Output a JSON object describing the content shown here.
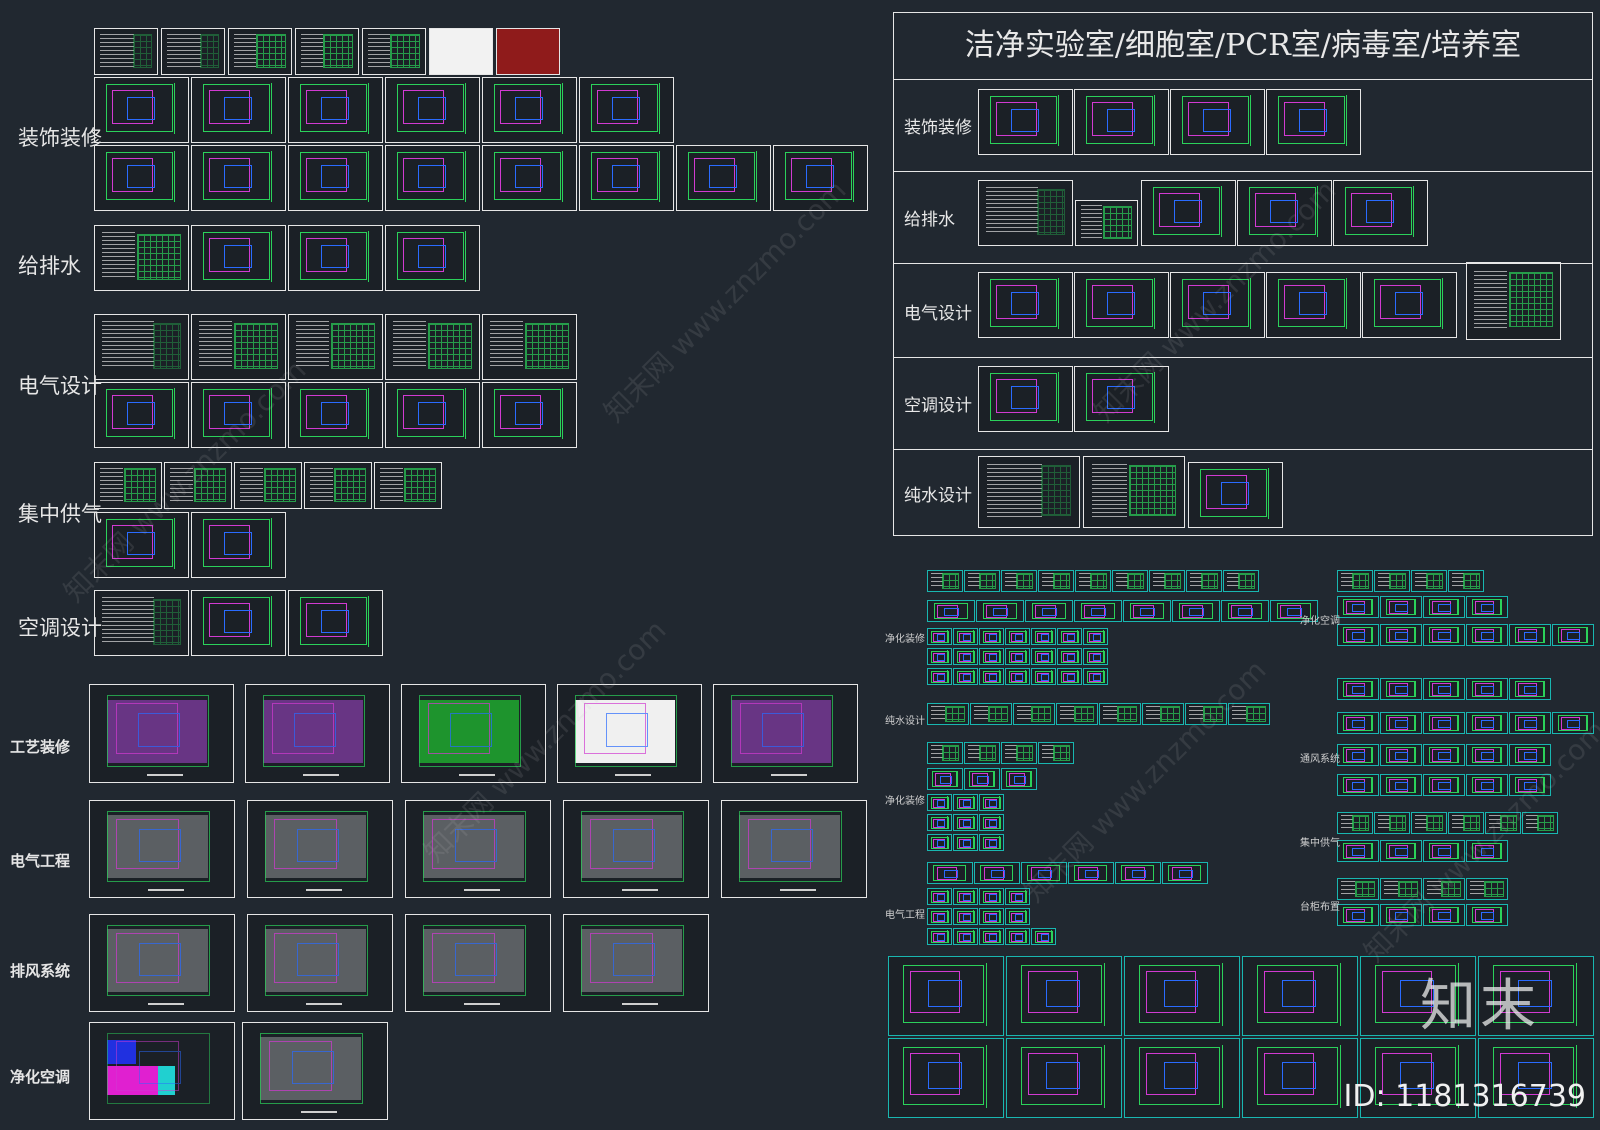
{
  "left_labels": [
    "装饰装修",
    "给排水",
    "电气设计",
    "集中供气",
    "空调设计"
  ],
  "bottom_labels": [
    "工艺装修",
    "电气工程",
    "排风系统",
    "净化空调"
  ],
  "panel": {
    "title": "洁净实验室/细胞室/PCR室/病毒室/培养室",
    "rows": [
      "装饰装修",
      "给排水",
      "电气设计",
      "空调设计",
      "纯水设计"
    ]
  },
  "small_mid_labels": [
    "净化装修",
    "纯水设计",
    "净化装修",
    "电气工程"
  ],
  "small_right_labels": [
    "净化空调",
    "通风系统",
    "集中供气",
    "台柜布置"
  ],
  "watermark": "知末网 www.znzmo.com",
  "logo": "知末",
  "id_text": "ID: 1181316739",
  "colors": {
    "background": "#212830",
    "sheet_border": "#e6e6e6",
    "teal_border": "#19b6b0",
    "cad_green": "#2bd15a",
    "cad_magenta": "#d23ad2",
    "cad_blue": "#2a6bff"
  }
}
